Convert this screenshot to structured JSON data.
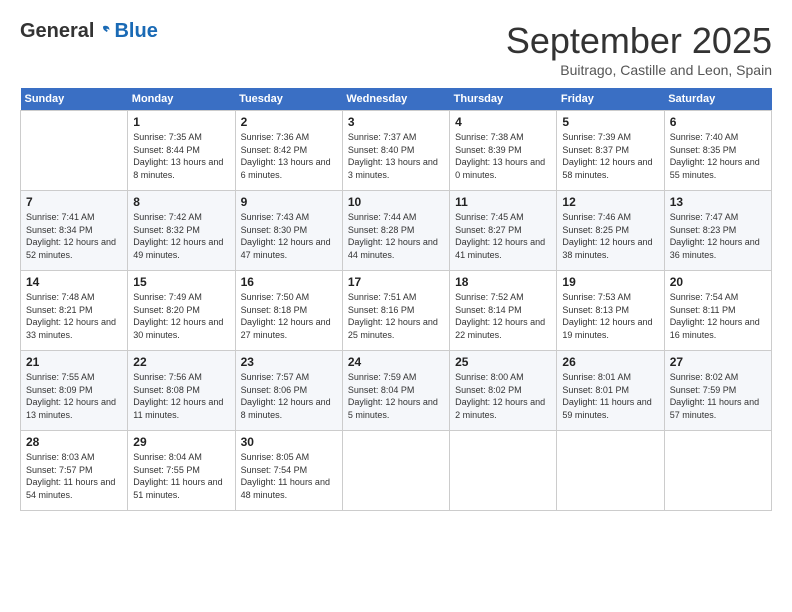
{
  "header": {
    "logo_general": "General",
    "logo_blue": "Blue",
    "month": "September 2025",
    "location": "Buitrago, Castille and Leon, Spain"
  },
  "weekdays": [
    "Sunday",
    "Monday",
    "Tuesday",
    "Wednesday",
    "Thursday",
    "Friday",
    "Saturday"
  ],
  "weeks": [
    [
      {
        "day": "",
        "empty": true
      },
      {
        "day": "1",
        "sunrise": "7:35 AM",
        "sunset": "8:44 PM",
        "daylight": "13 hours and 8 minutes."
      },
      {
        "day": "2",
        "sunrise": "7:36 AM",
        "sunset": "8:42 PM",
        "daylight": "13 hours and 6 minutes."
      },
      {
        "day": "3",
        "sunrise": "7:37 AM",
        "sunset": "8:40 PM",
        "daylight": "13 hours and 3 minutes."
      },
      {
        "day": "4",
        "sunrise": "7:38 AM",
        "sunset": "8:39 PM",
        "daylight": "13 hours and 0 minutes."
      },
      {
        "day": "5",
        "sunrise": "7:39 AM",
        "sunset": "8:37 PM",
        "daylight": "12 hours and 58 minutes."
      },
      {
        "day": "6",
        "sunrise": "7:40 AM",
        "sunset": "8:35 PM",
        "daylight": "12 hours and 55 minutes."
      }
    ],
    [
      {
        "day": "7",
        "sunrise": "7:41 AM",
        "sunset": "8:34 PM",
        "daylight": "12 hours and 52 minutes."
      },
      {
        "day": "8",
        "sunrise": "7:42 AM",
        "sunset": "8:32 PM",
        "daylight": "12 hours and 49 minutes."
      },
      {
        "day": "9",
        "sunrise": "7:43 AM",
        "sunset": "8:30 PM",
        "daylight": "12 hours and 47 minutes."
      },
      {
        "day": "10",
        "sunrise": "7:44 AM",
        "sunset": "8:28 PM",
        "daylight": "12 hours and 44 minutes."
      },
      {
        "day": "11",
        "sunrise": "7:45 AM",
        "sunset": "8:27 PM",
        "daylight": "12 hours and 41 minutes."
      },
      {
        "day": "12",
        "sunrise": "7:46 AM",
        "sunset": "8:25 PM",
        "daylight": "12 hours and 38 minutes."
      },
      {
        "day": "13",
        "sunrise": "7:47 AM",
        "sunset": "8:23 PM",
        "daylight": "12 hours and 36 minutes."
      }
    ],
    [
      {
        "day": "14",
        "sunrise": "7:48 AM",
        "sunset": "8:21 PM",
        "daylight": "12 hours and 33 minutes."
      },
      {
        "day": "15",
        "sunrise": "7:49 AM",
        "sunset": "8:20 PM",
        "daylight": "12 hours and 30 minutes."
      },
      {
        "day": "16",
        "sunrise": "7:50 AM",
        "sunset": "8:18 PM",
        "daylight": "12 hours and 27 minutes."
      },
      {
        "day": "17",
        "sunrise": "7:51 AM",
        "sunset": "8:16 PM",
        "daylight": "12 hours and 25 minutes."
      },
      {
        "day": "18",
        "sunrise": "7:52 AM",
        "sunset": "8:14 PM",
        "daylight": "12 hours and 22 minutes."
      },
      {
        "day": "19",
        "sunrise": "7:53 AM",
        "sunset": "8:13 PM",
        "daylight": "12 hours and 19 minutes."
      },
      {
        "day": "20",
        "sunrise": "7:54 AM",
        "sunset": "8:11 PM",
        "daylight": "12 hours and 16 minutes."
      }
    ],
    [
      {
        "day": "21",
        "sunrise": "7:55 AM",
        "sunset": "8:09 PM",
        "daylight": "12 hours and 13 minutes."
      },
      {
        "day": "22",
        "sunrise": "7:56 AM",
        "sunset": "8:08 PM",
        "daylight": "12 hours and 11 minutes."
      },
      {
        "day": "23",
        "sunrise": "7:57 AM",
        "sunset": "8:06 PM",
        "daylight": "12 hours and 8 minutes."
      },
      {
        "day": "24",
        "sunrise": "7:59 AM",
        "sunset": "8:04 PM",
        "daylight": "12 hours and 5 minutes."
      },
      {
        "day": "25",
        "sunrise": "8:00 AM",
        "sunset": "8:02 PM",
        "daylight": "12 hours and 2 minutes."
      },
      {
        "day": "26",
        "sunrise": "8:01 AM",
        "sunset": "8:01 PM",
        "daylight": "11 hours and 59 minutes."
      },
      {
        "day": "27",
        "sunrise": "8:02 AM",
        "sunset": "7:59 PM",
        "daylight": "11 hours and 57 minutes."
      }
    ],
    [
      {
        "day": "28",
        "sunrise": "8:03 AM",
        "sunset": "7:57 PM",
        "daylight": "11 hours and 54 minutes."
      },
      {
        "day": "29",
        "sunrise": "8:04 AM",
        "sunset": "7:55 PM",
        "daylight": "11 hours and 51 minutes."
      },
      {
        "day": "30",
        "sunrise": "8:05 AM",
        "sunset": "7:54 PM",
        "daylight": "11 hours and 48 minutes."
      },
      {
        "day": "",
        "empty": true
      },
      {
        "day": "",
        "empty": true
      },
      {
        "day": "",
        "empty": true
      },
      {
        "day": "",
        "empty": true
      }
    ]
  ]
}
